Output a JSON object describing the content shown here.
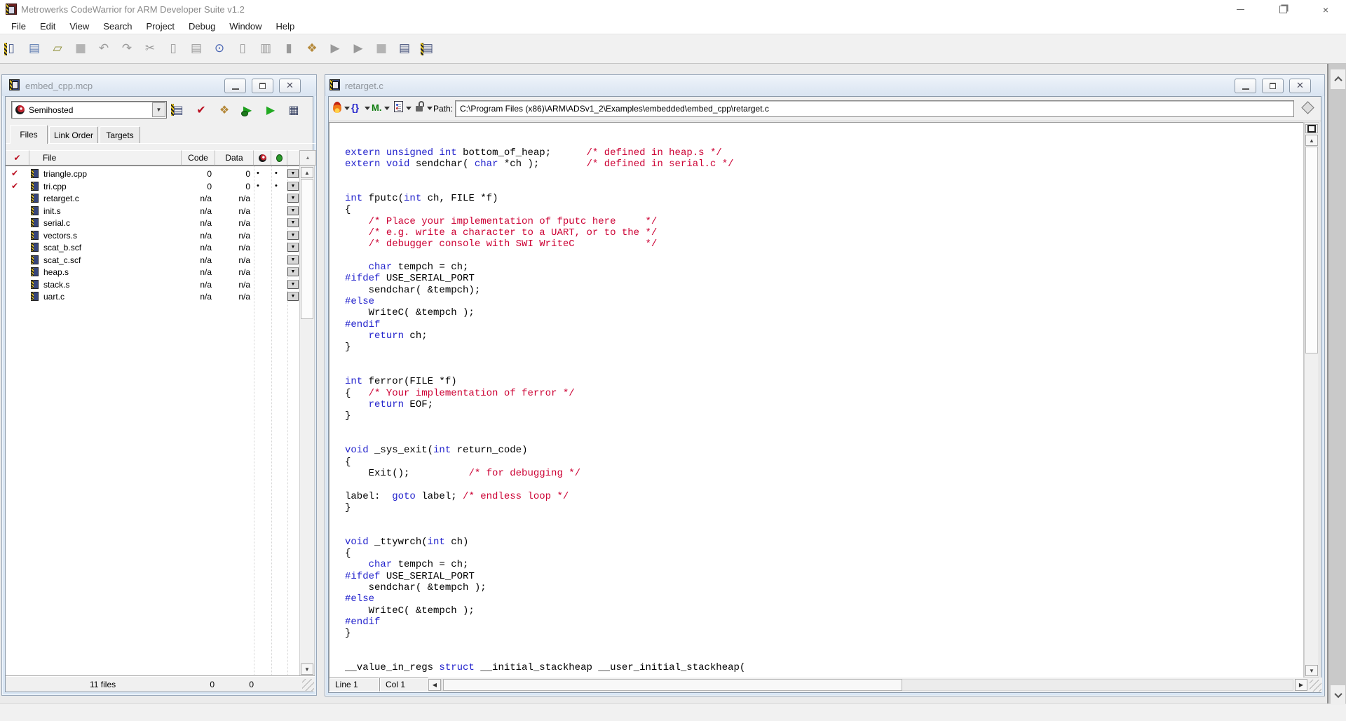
{
  "colors": {
    "keyword": "#2222cc",
    "comment": "#cc0033",
    "check_red": "#bb1122",
    "run_green": "#22aa22"
  },
  "main_window": {
    "title": "Metrowerks CodeWarrior for ARM Developer Suite v1.2",
    "menus": [
      "File",
      "Edit",
      "View",
      "Search",
      "Project",
      "Debug",
      "Window",
      "Help"
    ],
    "toolbar": [
      {
        "name": "new-file-icon",
        "glyph": "▯",
        "color": "#3a4f86",
        "haz": true
      },
      {
        "name": "new-project-icon",
        "glyph": "▤",
        "color": "#5b7ab0"
      },
      {
        "name": "open-icon",
        "glyph": "▱",
        "color": "#8a8a30"
      },
      {
        "name": "save-icon",
        "glyph": "■",
        "color": "#b4b4b4"
      },
      {
        "name": "undo-icon",
        "glyph": "↶",
        "color": "#9a9a9a"
      },
      {
        "name": "redo-icon",
        "glyph": "↷",
        "color": "#9a9a9a"
      },
      {
        "name": "cut-icon",
        "glyph": "✂",
        "color": "#9a9a9a"
      },
      {
        "name": "copy-icon",
        "glyph": "▯",
        "color": "#9a9a9a"
      },
      {
        "name": "paste-icon",
        "glyph": "▤",
        "color": "#9a9a9a"
      },
      {
        "name": "find-icon",
        "glyph": "⊙",
        "color": "#4a66b4"
      },
      {
        "name": "find-next-icon",
        "glyph": "▯",
        "color": "#9a9a9a"
      },
      {
        "name": "replace-icon",
        "glyph": "▥",
        "color": "#9a9a9a"
      },
      {
        "name": "bookmark-icon",
        "glyph": "▮",
        "color": "#9a9a9a"
      },
      {
        "name": "make-icon",
        "glyph": "❖",
        "color": "#b5893a"
      },
      {
        "name": "debug-icon",
        "glyph": "▶",
        "color": "#9a9a9a"
      },
      {
        "name": "run-icon",
        "glyph": "▶",
        "color": "#9a9a9a"
      },
      {
        "name": "stop-icon",
        "glyph": "■",
        "color": "#b4b4b4"
      },
      {
        "name": "settings-icon",
        "glyph": "▤",
        "color": "#44507a"
      },
      {
        "name": "target-settings-icon",
        "glyph": "▤",
        "color": "#44507a",
        "haz": true
      }
    ]
  },
  "project_window": {
    "title": "embed_cpp.mcp",
    "target_selector": "Semihosted",
    "toolbar": [
      {
        "name": "target-settings-icon",
        "glyph": "▤",
        "color": "#44507a",
        "haz": true
      },
      {
        "name": "check-syntax-icon",
        "glyph": "✔",
        "color": "#bb1122"
      },
      {
        "name": "make-icon",
        "glyph": "❖",
        "color": "#b5893a"
      },
      {
        "name": "debug-icon",
        "glyph": "▶",
        "color": "#1d9e1d",
        "bug": true
      },
      {
        "name": "run-icon",
        "glyph": "▶",
        "color": "#22aa22"
      },
      {
        "name": "inspector-icon",
        "glyph": "▦",
        "color": "#3c4666"
      }
    ],
    "tabs": [
      "Files",
      "Link Order",
      "Targets"
    ],
    "active_tab": "Files",
    "table": {
      "col_check": "✔",
      "col_file": "File",
      "col_code": "Code",
      "col_data": "Data",
      "rows": [
        {
          "checked": true,
          "name": "triangle.cpp",
          "code": "0",
          "data": "0",
          "dots": true
        },
        {
          "checked": true,
          "name": "tri.cpp",
          "code": "0",
          "data": "0",
          "dots": true
        },
        {
          "checked": false,
          "name": "retarget.c",
          "code": "n/a",
          "data": "n/a",
          "dots": false
        },
        {
          "checked": false,
          "name": "init.s",
          "code": "n/a",
          "data": "n/a",
          "dots": false
        },
        {
          "checked": false,
          "name": "serial.c",
          "code": "n/a",
          "data": "n/a",
          "dots": false
        },
        {
          "checked": false,
          "name": "vectors.s",
          "code": "n/a",
          "data": "n/a",
          "dots": false
        },
        {
          "checked": false,
          "name": "scat_b.scf",
          "code": "n/a",
          "data": "n/a",
          "dots": false
        },
        {
          "checked": false,
          "name": "scat_c.scf",
          "code": "n/a",
          "data": "n/a",
          "dots": false
        },
        {
          "checked": false,
          "name": "heap.s",
          "code": "n/a",
          "data": "n/a",
          "dots": false
        },
        {
          "checked": false,
          "name": "stack.s",
          "code": "n/a",
          "data": "n/a",
          "dots": false
        },
        {
          "checked": false,
          "name": "uart.c",
          "code": "n/a",
          "data": "n/a",
          "dots": false
        }
      ]
    },
    "status": {
      "files_count": "11 files",
      "code_total": "0",
      "data_total": "0"
    }
  },
  "editor_window": {
    "title": "retarget.c",
    "toolbar": {
      "braces": "{}",
      "marker": "M.",
      "path_label": "Path:",
      "path": "C:\\Program Files (x86)\\ARM\\ADSv1_2\\Examples\\embedded\\embed_cpp\\retarget.c"
    },
    "status": {
      "line": "Line 1",
      "col": "Col 1"
    },
    "code_lines": [
      [],
      [],
      [
        [
          "k",
          "extern"
        ],
        [
          "p",
          " "
        ],
        [
          "k",
          "unsigned"
        ],
        [
          "p",
          " "
        ],
        [
          "k",
          "int"
        ],
        [
          "p",
          " bottom_of_heap;      "
        ],
        [
          "c",
          "/* defined in heap.s */"
        ]
      ],
      [
        [
          "k",
          "extern"
        ],
        [
          "p",
          " "
        ],
        [
          "k",
          "void"
        ],
        [
          "p",
          " sendchar( "
        ],
        [
          "k",
          "char"
        ],
        [
          "p",
          " *ch );        "
        ],
        [
          "c",
          "/* defined in serial.c */"
        ]
      ],
      [],
      [],
      [
        [
          "k",
          "int"
        ],
        [
          "p",
          " fputc("
        ],
        [
          "k",
          "int"
        ],
        [
          "p",
          " ch, FILE *f)"
        ]
      ],
      [
        [
          "p",
          "{"
        ]
      ],
      [
        [
          "p",
          "    "
        ],
        [
          "c",
          "/* Place your implementation of fputc here     */"
        ]
      ],
      [
        [
          "p",
          "    "
        ],
        [
          "c",
          "/* e.g. write a character to a UART, or to the */"
        ]
      ],
      [
        [
          "p",
          "    "
        ],
        [
          "c",
          "/* debugger console with SWI WriteC            */"
        ]
      ],
      [],
      [
        [
          "p",
          "    "
        ],
        [
          "k",
          "char"
        ],
        [
          "p",
          " tempch = ch;"
        ]
      ],
      [
        [
          "k",
          "#ifdef"
        ],
        [
          "p",
          " USE_SERIAL_PORT"
        ]
      ],
      [
        [
          "p",
          "    sendchar( &tempch);"
        ]
      ],
      [
        [
          "k",
          "#else"
        ]
      ],
      [
        [
          "p",
          "    WriteC( &tempch );"
        ]
      ],
      [
        [
          "k",
          "#endif"
        ]
      ],
      [
        [
          "p",
          "    "
        ],
        [
          "k",
          "return"
        ],
        [
          "p",
          " ch;"
        ]
      ],
      [
        [
          "p",
          "}"
        ]
      ],
      [],
      [],
      [
        [
          "k",
          "int"
        ],
        [
          "p",
          " ferror(FILE *f)"
        ]
      ],
      [
        [
          "p",
          "{   "
        ],
        [
          "c",
          "/* Your implementation of ferror */"
        ]
      ],
      [
        [
          "p",
          "    "
        ],
        [
          "k",
          "return"
        ],
        [
          "p",
          " EOF;"
        ]
      ],
      [
        [
          "p",
          "}"
        ]
      ],
      [],
      [],
      [
        [
          "k",
          "void"
        ],
        [
          "p",
          " _sys_exit("
        ],
        [
          "k",
          "int"
        ],
        [
          "p",
          " return_code)"
        ]
      ],
      [
        [
          "p",
          "{"
        ]
      ],
      [
        [
          "p",
          "    Exit();          "
        ],
        [
          "c",
          "/* for debugging */"
        ]
      ],
      [],
      [
        [
          "p",
          "label:  "
        ],
        [
          "k",
          "goto"
        ],
        [
          "p",
          " label; "
        ],
        [
          "c",
          "/* endless loop */"
        ]
      ],
      [
        [
          "p",
          "}"
        ]
      ],
      [],
      [],
      [
        [
          "k",
          "void"
        ],
        [
          "p",
          " _ttywrch("
        ],
        [
          "k",
          "int"
        ],
        [
          "p",
          " ch)"
        ]
      ],
      [
        [
          "p",
          "{"
        ]
      ],
      [
        [
          "p",
          "    "
        ],
        [
          "k",
          "char"
        ],
        [
          "p",
          " tempch = ch;"
        ]
      ],
      [
        [
          "k",
          "#ifdef"
        ],
        [
          "p",
          " USE_SERIAL_PORT"
        ]
      ],
      [
        [
          "p",
          "    sendchar( &tempch );"
        ]
      ],
      [
        [
          "k",
          "#else"
        ]
      ],
      [
        [
          "p",
          "    WriteC( &tempch );"
        ]
      ],
      [
        [
          "k",
          "#endif"
        ]
      ],
      [
        [
          "p",
          "}"
        ]
      ],
      [],
      [],
      [
        [
          "p",
          "__value_in_regs "
        ],
        [
          "k",
          "struct"
        ],
        [
          "p",
          " __initial_stackheap __user_initial_stackheap("
        ]
      ]
    ]
  }
}
